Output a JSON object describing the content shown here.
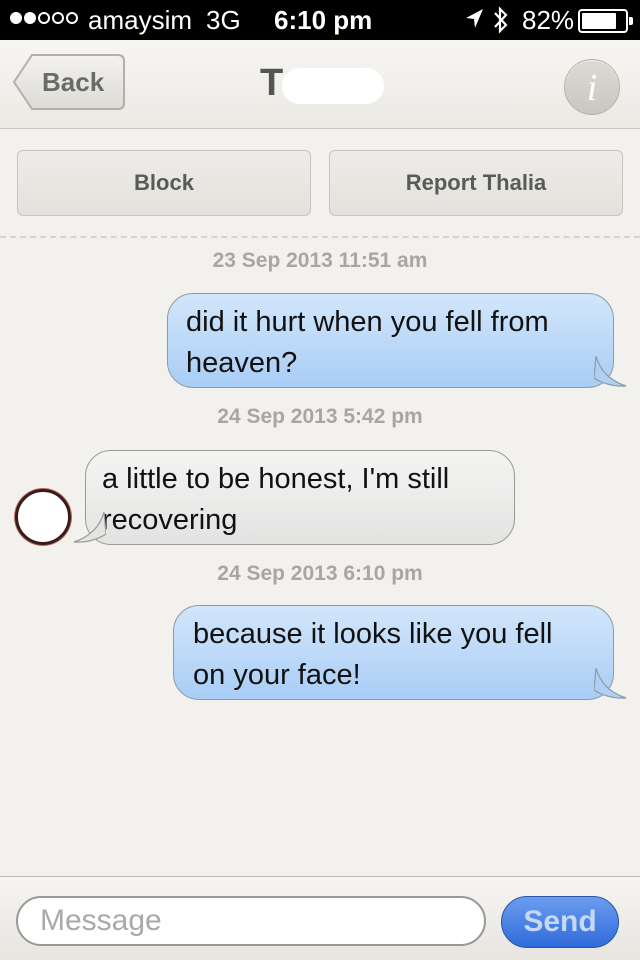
{
  "status_bar": {
    "signal_bars": [
      true,
      true,
      false,
      false,
      false
    ],
    "carrier": "amaysim",
    "network": "3G",
    "time": "6:10 pm",
    "battery": "82%",
    "battery_level": 0.82,
    "icons": [
      "location-arrow-icon",
      "bluetooth-icon",
      "battery-icon"
    ]
  },
  "nav": {
    "back_label": "Back",
    "title": "T",
    "info_glyph": "i"
  },
  "actions": {
    "block_label": "Block",
    "report_label": "Report Thalia"
  },
  "messages": [
    {
      "timestamp": "23 Sep 2013 11:51 am",
      "direction": "outgoing",
      "lines": [
        "did it hurt when you fell from",
        "heaven?"
      ]
    },
    {
      "timestamp": "24 Sep 2013 5:42 pm",
      "direction": "incoming",
      "lines": [
        "a little to be honest, I'm still",
        "recovering"
      ]
    },
    {
      "timestamp": "24 Sep 2013 6:10 pm",
      "direction": "outgoing",
      "lines": [
        "because it looks like you fell",
        "on your face!"
      ]
    }
  ],
  "composer": {
    "placeholder": "Message",
    "value": "",
    "send_label": "Send"
  },
  "colors": {
    "outgoing_bubble": "#b9d8f8",
    "incoming_bubble": "#ececeb",
    "send_button": "#3f7be0",
    "background": "#f2f1ee"
  }
}
